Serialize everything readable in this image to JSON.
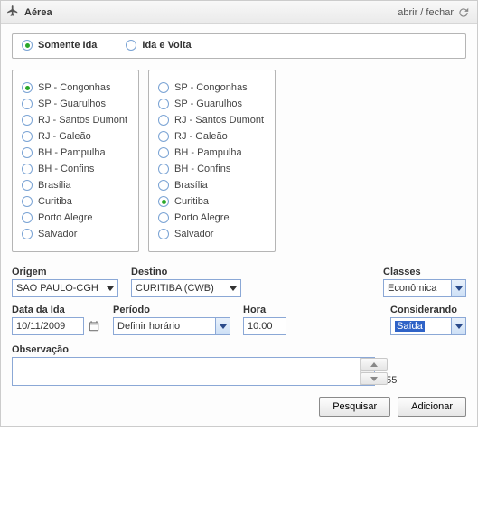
{
  "header": {
    "title": "Aérea",
    "toggle_label": "abrir / fechar"
  },
  "trip_type": {
    "one_way": {
      "label": "Somente Ida",
      "checked": true
    },
    "round": {
      "label": "Ida e Volta",
      "checked": false
    }
  },
  "origin_cities": [
    {
      "label": "SP - Congonhas",
      "checked": true
    },
    {
      "label": "SP - Guarulhos",
      "checked": false
    },
    {
      "label": "RJ - Santos Dumont",
      "checked": false
    },
    {
      "label": "RJ - Galeão",
      "checked": false
    },
    {
      "label": "BH - Pampulha",
      "checked": false
    },
    {
      "label": "BH - Confins",
      "checked": false
    },
    {
      "label": "Brasília",
      "checked": false
    },
    {
      "label": "Curitiba",
      "checked": false
    },
    {
      "label": "Porto Alegre",
      "checked": false
    },
    {
      "label": "Salvador",
      "checked": false
    }
  ],
  "dest_cities": [
    {
      "label": "SP - Congonhas",
      "checked": false
    },
    {
      "label": "SP - Guarulhos",
      "checked": false
    },
    {
      "label": "RJ - Santos Dumont",
      "checked": false
    },
    {
      "label": "RJ - Galeão",
      "checked": false
    },
    {
      "label": "BH - Pampulha",
      "checked": false
    },
    {
      "label": "BH - Confins",
      "checked": false
    },
    {
      "label": "Brasília",
      "checked": false
    },
    {
      "label": "Curitiba",
      "checked": true
    },
    {
      "label": "Porto Alegre",
      "checked": false
    },
    {
      "label": "Salvador",
      "checked": false
    }
  ],
  "fields": {
    "origem": {
      "label": "Origem",
      "value": "SAO PAULO-CGH"
    },
    "destino": {
      "label": "Destino",
      "value": "CURITIBA (CWB)"
    },
    "classes": {
      "label": "Classes",
      "value": "Econômica"
    },
    "data_ida": {
      "label": "Data da Ida",
      "value": "10/11/2009"
    },
    "periodo": {
      "label": "Período",
      "value": "Definir horário"
    },
    "hora": {
      "label": "Hora",
      "value": "10:00"
    },
    "considerando": {
      "label": "Considerando",
      "value": "Saída"
    }
  },
  "observacao": {
    "label": "Observação",
    "counter": "255"
  },
  "buttons": {
    "pesquisar": "Pesquisar",
    "adicionar": "Adicionar"
  }
}
